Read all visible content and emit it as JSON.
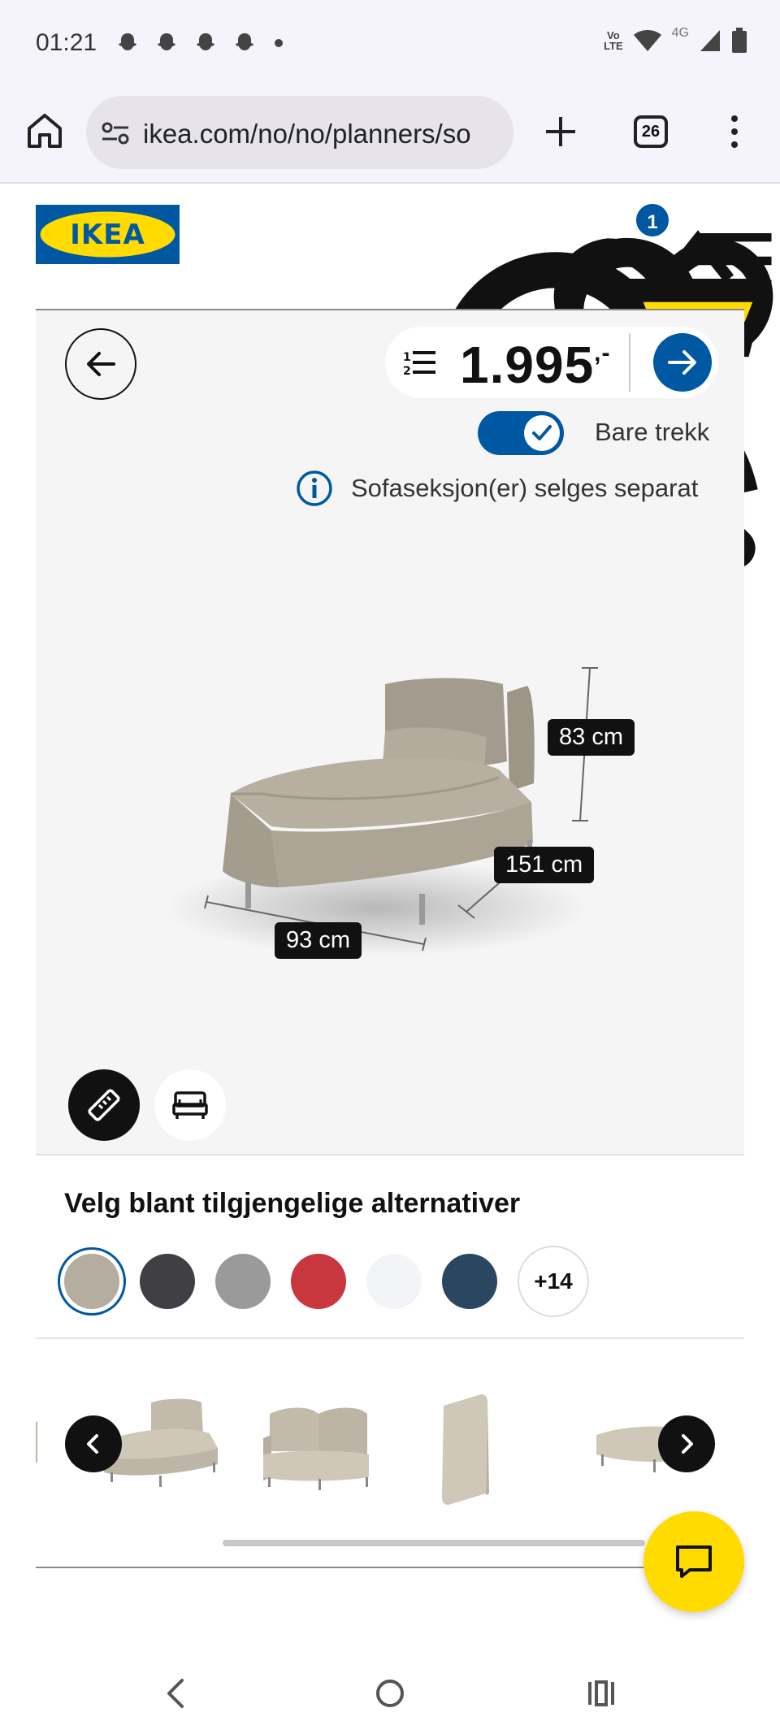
{
  "status_bar": {
    "time": "01:21",
    "network_label_top": "Vo",
    "network_label_bottom": "LTE",
    "cell_type": "4G"
  },
  "browser": {
    "url": "ikea.com/no/no/planners/so",
    "tab_count": "26"
  },
  "header": {
    "logo_text": "IKEA",
    "cart_count": "1"
  },
  "planner": {
    "price": "1.995",
    "price_suffix": ",-",
    "toggle_label": "Bare trekk",
    "toggle_on": true,
    "info_text": "Sofaseksjon(er) selges separat",
    "dimensions": {
      "height": "83 cm",
      "depth": "151 cm",
      "width": "93 cm"
    }
  },
  "options": {
    "title": "Velg blant tilgjengelige alternativer",
    "swatches": [
      {
        "color": "#b5ad9f",
        "selected": true
      },
      {
        "color": "#3f3f44",
        "selected": false
      },
      {
        "color": "#9a9a9a",
        "selected": false
      },
      {
        "color": "#c8363e",
        "selected": false
      },
      {
        "color": "#f2f4f8",
        "selected": false
      },
      {
        "color": "#2a4661",
        "selected": false
      }
    ],
    "more_label": "+14"
  },
  "carousel": {
    "items": [
      "chaise-longue",
      "corner-section",
      "backrest-cushion",
      "seat-section"
    ]
  },
  "colors": {
    "ikea_blue": "#0058a3",
    "ikea_yellow": "#ffdb00"
  }
}
